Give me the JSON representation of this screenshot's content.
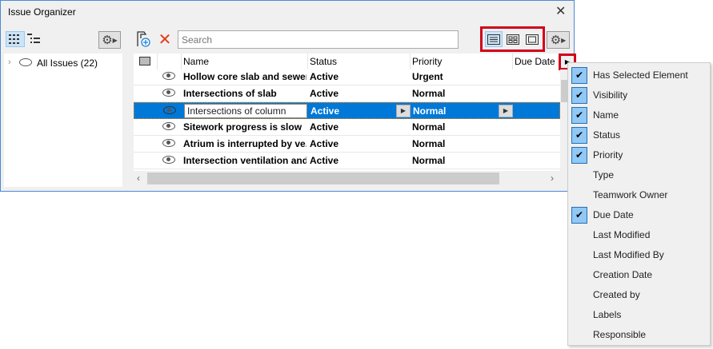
{
  "window": {
    "title": "Issue Organizer",
    "close_icon": "close-icon"
  },
  "left": {
    "tree_root": "All Issues (22)"
  },
  "toolbar": {
    "search_placeholder": "Search"
  },
  "table": {
    "columns": [
      "Name",
      "Status",
      "Priority",
      "Due Date"
    ],
    "rows": [
      {
        "name": "Hollow core slab and sewer ...",
        "status": "Active",
        "priority": "Urgent",
        "selected": false
      },
      {
        "name": "Intersections of slab",
        "status": "Active",
        "priority": "Normal",
        "selected": false
      },
      {
        "name": "Intersections of column",
        "status": "Active",
        "priority": "Normal",
        "selected": true
      },
      {
        "name": "Sitework progress is slow",
        "status": "Active",
        "priority": "Normal",
        "selected": false
      },
      {
        "name": "Atrium is interrupted by ve...",
        "status": "Active",
        "priority": "Normal",
        "selected": false
      },
      {
        "name": "Intersection ventilation and...",
        "status": "Active",
        "priority": "Normal",
        "selected": false
      }
    ]
  },
  "column_menu": {
    "items": [
      {
        "label": "Has Selected Element",
        "checked": true
      },
      {
        "label": "Visibility",
        "checked": true
      },
      {
        "label": "Name",
        "checked": true
      },
      {
        "label": "Status",
        "checked": true
      },
      {
        "label": "Priority",
        "checked": true
      },
      {
        "label": "Type",
        "checked": false
      },
      {
        "label": "Teamwork Owner",
        "checked": false
      },
      {
        "label": "Due Date",
        "checked": true
      },
      {
        "label": "Last Modified",
        "checked": false
      },
      {
        "label": "Last Modified By",
        "checked": false
      },
      {
        "label": "Creation Date",
        "checked": false
      },
      {
        "label": "Created by",
        "checked": false
      },
      {
        "label": "Labels",
        "checked": false
      },
      {
        "label": "Responsible",
        "checked": false
      }
    ]
  },
  "colors": {
    "selection": "#0078d7",
    "highlight": "#d0021b",
    "delete": "#e53a1e"
  }
}
